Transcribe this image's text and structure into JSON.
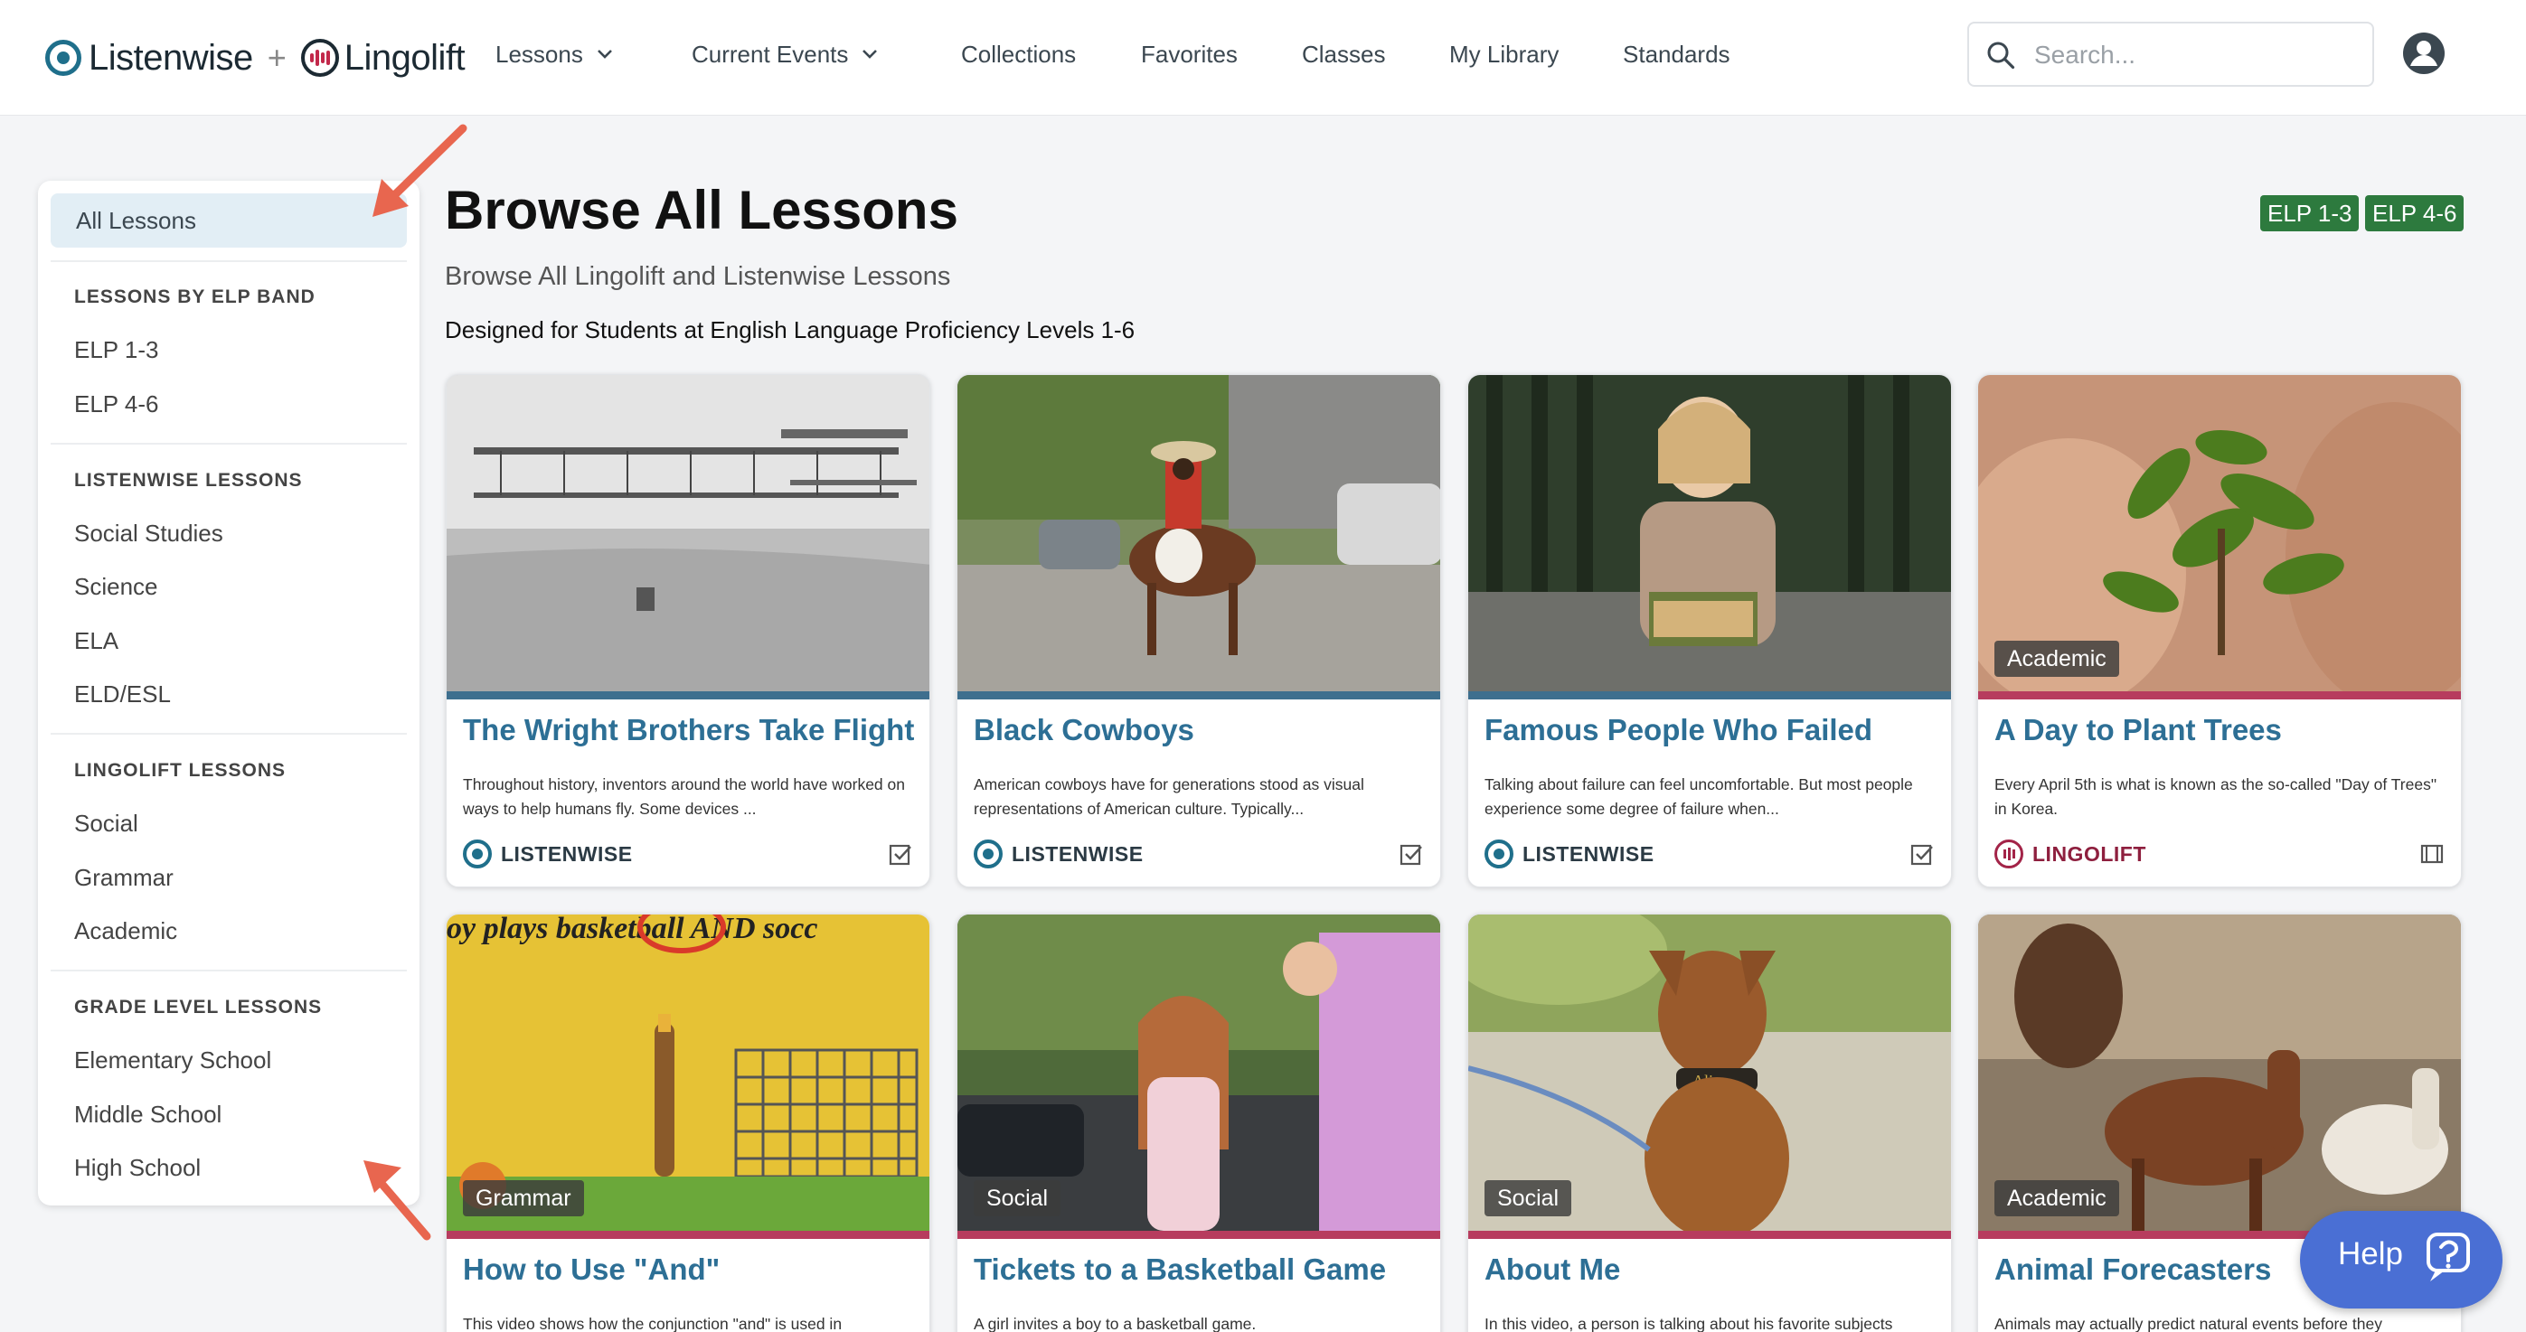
{
  "header": {
    "logo_listenwise": "Listenwise",
    "logo_plus": "+",
    "logo_lingolift": "Lingolift",
    "nav": [
      {
        "label": "Lessons",
        "dropdown": true
      },
      {
        "label": "Current Events",
        "dropdown": true
      },
      {
        "label": "Collections",
        "dropdown": false
      },
      {
        "label": "Favorites",
        "dropdown": false
      },
      {
        "label": "Classes",
        "dropdown": false
      },
      {
        "label": "My Library",
        "dropdown": false
      },
      {
        "label": "Standards",
        "dropdown": false
      }
    ],
    "search_placeholder": "Search...",
    "search_value": ""
  },
  "sidebar": {
    "active": "All Lessons",
    "sections": [
      {
        "heading": "LESSONS BY ELP BAND",
        "items": [
          "ELP 1-3",
          "ELP 4-6"
        ]
      },
      {
        "heading": "LISTENWISE LESSONS",
        "items": [
          "Social Studies",
          "Science",
          "ELA",
          "ELD/ESL"
        ]
      },
      {
        "heading": "LINGOLIFT LESSONS",
        "items": [
          "Social",
          "Grammar",
          "Academic"
        ]
      },
      {
        "heading": "GRADE LEVEL LESSONS",
        "items": [
          "Elementary School",
          "Middle School",
          "High School"
        ]
      }
    ]
  },
  "main": {
    "title": "Browse All Lessons",
    "subtitle": "Browse All Lingolift and Listenwise Lessons",
    "description": "Designed for Students at English Language Proficiency Levels 1-6",
    "badges": [
      "ELP 1-3",
      "ELP 4-6"
    ]
  },
  "cards": [
    {
      "title": "The Wright Brothers Take Flight",
      "text": "Throughout history, inventors around the world have worked on ways to help humans fly. Some devices ...",
      "brand": "LISTENWISE",
      "tag": "",
      "image": "airplane-photo"
    },
    {
      "title": "Black Cowboys",
      "text": "American cowboys have for generations stood as visual representations of American culture. Typically...",
      "brand": "LISTENWISE",
      "tag": "",
      "image": "cowboy-photo"
    },
    {
      "title": "Famous People Who Failed",
      "text": "Talking about failure can feel uncomfortable. But most people experience some degree of failure when...",
      "brand": "LISTENWISE",
      "tag": "",
      "image": "reader-photo"
    },
    {
      "title": "A Day to Plant Trees",
      "text": "Every April 5th is what is known as the so-called \"Day of Trees\" in Korea.",
      "brand": "LINGOLIFT",
      "tag": "Academic",
      "image": "seedling-photo"
    },
    {
      "title": "How to Use \"And\"",
      "text": "This video shows how the conjunction \"and\" is used in",
      "brand": "",
      "tag": "Grammar",
      "image": "cartoon-image",
      "banner": "oy plays basketball AND socc"
    },
    {
      "title": "Tickets to a Basketball Game",
      "text": "A girl invites a boy to a basketball game.",
      "brand": "",
      "tag": "Social",
      "image": "street-photo"
    },
    {
      "title": "About Me",
      "text": "In this video, a person is talking about his favorite subjects",
      "brand": "",
      "tag": "Social",
      "image": "dog-photo",
      "collar": "Ali"
    },
    {
      "title": "Animal Forecasters",
      "text": "Animals may actually predict natural events before they",
      "brand": "",
      "tag": "Academic",
      "image": "horses-photo"
    }
  ],
  "help": {
    "label": "Help"
  },
  "colors": {
    "link_blue": "#2d6f95",
    "listenwise_teal": "#1f6f8b",
    "lingolift_red": "#a32448",
    "badge_green": "#2d7a3e",
    "help_blue": "#4a6fd4",
    "annotation_arrow": "#e8664f"
  }
}
